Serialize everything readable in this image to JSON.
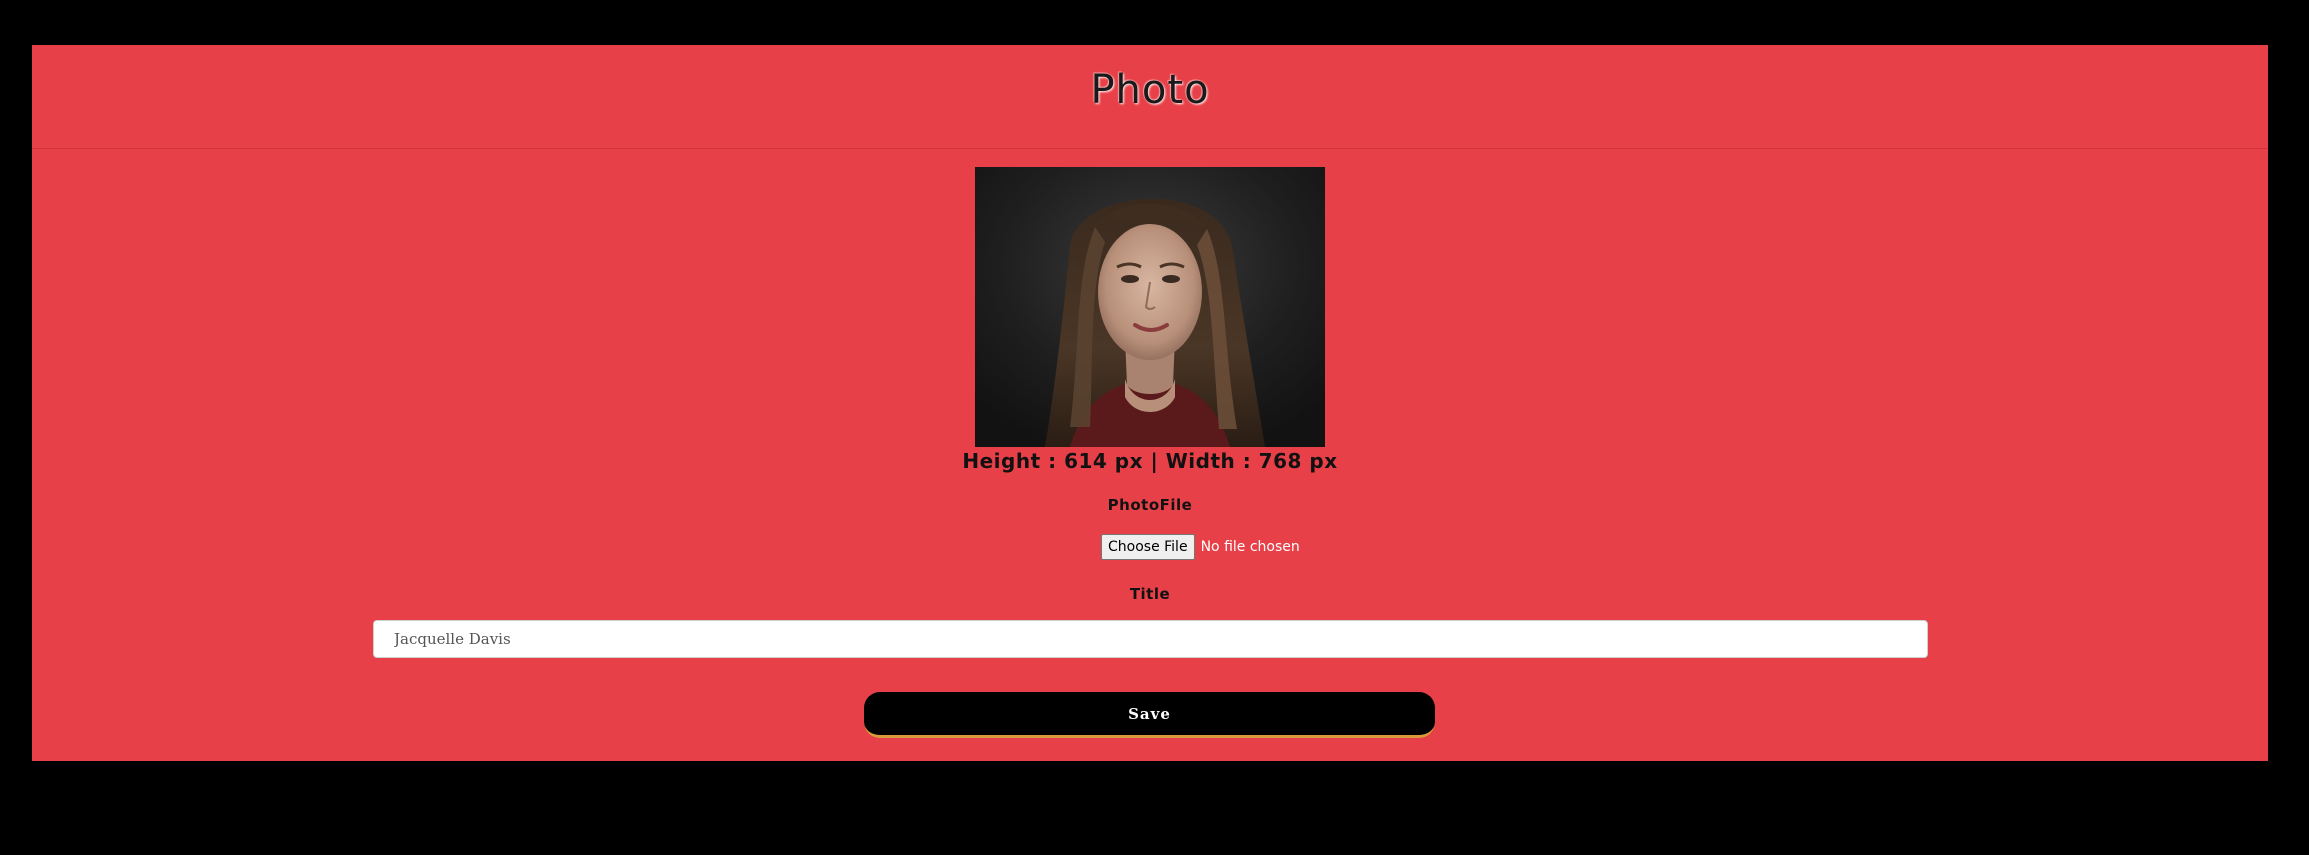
{
  "page": {
    "title": "Photo"
  },
  "photo": {
    "alt": "Jacquelle Davis portrait",
    "dimensions_text": "Height : 614 px | Width : 768 px"
  },
  "form": {
    "photo_file_label": "PhotoFile",
    "choose_file_label": "Choose File",
    "file_status": "No file chosen",
    "title_label": "Title",
    "title_value": "Jacquelle Davis",
    "save_label": "Save"
  },
  "colors": {
    "panel": "#e84048",
    "background": "#000000",
    "save_button": "#000000",
    "save_accent": "#d99a3a"
  }
}
